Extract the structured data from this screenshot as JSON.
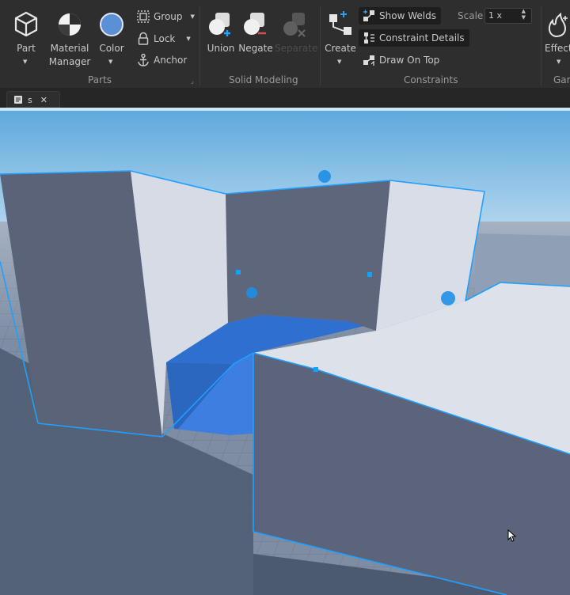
{
  "ribbon": {
    "parts": {
      "section_label": "Parts",
      "part_label": "Part",
      "material_label_1": "Material",
      "material_label_2": "Manager",
      "color_label": "Color",
      "group_label": "Group",
      "lock_label": "Lock",
      "anchor_label": "Anchor",
      "color_swatch": "#5b8fd6"
    },
    "solid_modeling": {
      "section_label": "Solid Modeling",
      "union_label": "Union",
      "negate_label": "Negate",
      "separate_label": "Separate"
    },
    "constraints": {
      "section_label": "Constraints",
      "create_label": "Create",
      "show_welds_label": "Show Welds",
      "constraint_details_label": "Constraint Details",
      "draw_on_top_label": "Draw On Top",
      "scale_label": "Scale",
      "scale_value": "1 x"
    },
    "effects": {
      "effects_label": "Effect",
      "gameplay_label": "Gar"
    }
  },
  "tabs": [
    {
      "label": "s",
      "close": "✕"
    }
  ],
  "icons": {
    "part": "cube-icon",
    "material": "material-sphere-icon",
    "color": "color-swatch-icon",
    "group": "group-icon",
    "lock": "lock-icon",
    "anchor": "anchor-icon",
    "union": "union-icon",
    "negate": "negate-icon",
    "separate": "separate-icon",
    "create": "create-constraint-icon",
    "show_welds": "welds-icon",
    "constraint_details": "constraint-details-icon",
    "draw_on_top": "draw-on-top-icon",
    "effects": "effects-icon",
    "script": "script-icon"
  },
  "colors": {
    "selection": "#1fa0ff",
    "sky_top": "#5fa9dd",
    "sky_horizon": "#cfe6f4",
    "ground": "#7f8da3"
  }
}
